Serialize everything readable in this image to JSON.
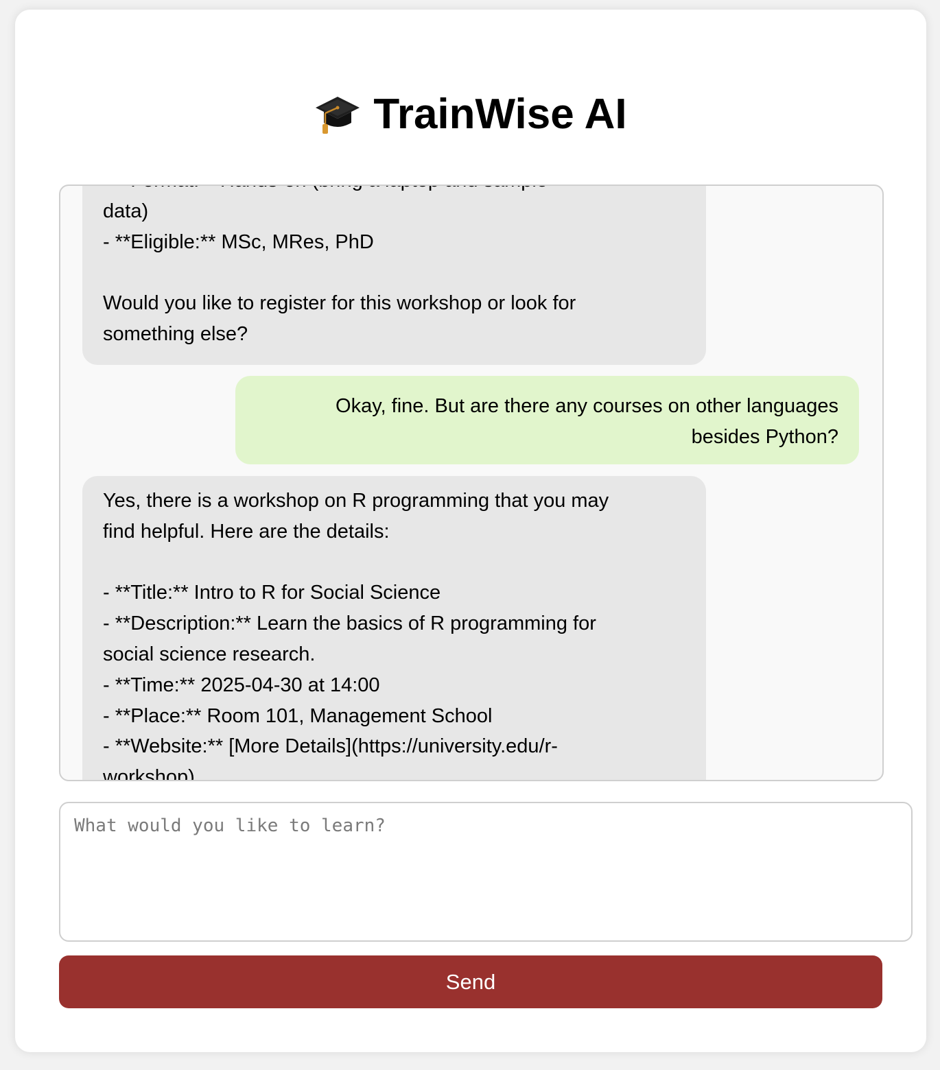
{
  "app": {
    "title": "TrainWise AI",
    "icon": "graduation-cap-icon"
  },
  "chat": {
    "messages": [
      {
        "role": "bot",
        "text": "- **Format:** Hands-on (bring a laptop and sample\ndata)\n- **Eligible:** MSc, MRes, PhD\n\nWould you like to register for this workshop or look for\nsomething else?"
      },
      {
        "role": "user",
        "text": "Okay, fine. But are there any courses on other languages\nbesides Python?"
      },
      {
        "role": "bot",
        "text": "Yes, there is a workshop on R programming that you may\nfind helpful. Here are the details:\n\n- **Title:** Intro to R for Social Science\n- **Description:** Learn the basics of R programming for\nsocial science research.\n- **Time:** 2025-04-30 at 14:00\n- **Place:** Room 101, Management School\n- **Website:** [More Details](https://university.edu/r-\nworkshop)"
      }
    ]
  },
  "composer": {
    "placeholder": "What would you like to learn?",
    "value": "",
    "send_label": "Send"
  },
  "colors": {
    "bot_bubble": "#e7e7e7",
    "user_bubble": "#e1f5cc",
    "send_button": "#99312e",
    "page_background": "#f2f2f2"
  }
}
